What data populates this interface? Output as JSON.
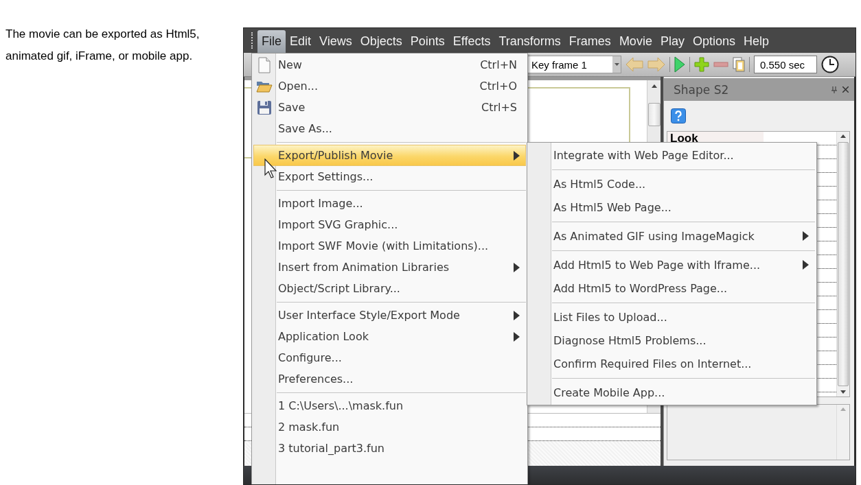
{
  "caption": "The movie can be exported as Html5, animated gif, iFrame, or mobile app.",
  "menubar": {
    "items": [
      {
        "label": "File",
        "selected": true
      },
      {
        "label": "Edit",
        "selected": false
      },
      {
        "label": "Views",
        "selected": false
      },
      {
        "label": "Objects",
        "selected": false
      },
      {
        "label": "Points",
        "selected": false
      },
      {
        "label": "Effects",
        "selected": false
      },
      {
        "label": "Transforms",
        "selected": false
      },
      {
        "label": "Frames",
        "selected": false
      },
      {
        "label": "Movie",
        "selected": false
      },
      {
        "label": "Play",
        "selected": false
      },
      {
        "label": "Options",
        "selected": false
      },
      {
        "label": "Help",
        "selected": false
      }
    ]
  },
  "toolbar": {
    "frame_select": "Key frame 1",
    "time_field": "0.550 sec"
  },
  "panel": {
    "title": "Shape S2",
    "section": "Look"
  },
  "file_menu": {
    "items": [
      {
        "kind": "item",
        "label": "New",
        "shortcut": "Ctrl+N",
        "selected": false,
        "has_submenu": false
      },
      {
        "kind": "item",
        "label": "Open...",
        "shortcut": "Ctrl+O",
        "selected": false,
        "has_submenu": false
      },
      {
        "kind": "item",
        "label": "Save",
        "shortcut": "Ctrl+S",
        "selected": false,
        "has_submenu": false
      },
      {
        "kind": "item",
        "label": "Save As...",
        "selected": false,
        "has_submenu": false
      },
      {
        "kind": "separator"
      },
      {
        "kind": "item",
        "label": "Export/Publish Movie",
        "selected": true,
        "has_submenu": true
      },
      {
        "kind": "item",
        "label": "Export Settings...",
        "selected": false,
        "has_submenu": false
      },
      {
        "kind": "separator"
      },
      {
        "kind": "item",
        "label": "Import Image...",
        "selected": false,
        "has_submenu": false
      },
      {
        "kind": "item",
        "label": "Import SVG Graphic...",
        "selected": false,
        "has_submenu": false
      },
      {
        "kind": "item",
        "label": "Import SWF Movie (with Limitations)...",
        "selected": false,
        "has_submenu": false
      },
      {
        "kind": "item",
        "label": "Insert from Animation Libraries",
        "selected": false,
        "has_submenu": true
      },
      {
        "kind": "item",
        "label": "Object/Script Library...",
        "selected": false,
        "has_submenu": false
      },
      {
        "kind": "separator"
      },
      {
        "kind": "item",
        "label": "User Interface Style/Export Mode",
        "selected": false,
        "has_submenu": true
      },
      {
        "kind": "item",
        "label": "Application Look",
        "selected": false,
        "has_submenu": true
      },
      {
        "kind": "item",
        "label": "Configure...",
        "selected": false,
        "has_submenu": false
      },
      {
        "kind": "item",
        "label": "Preferences...",
        "selected": false,
        "has_submenu": false
      },
      {
        "kind": "separator"
      },
      {
        "kind": "item",
        "label": "1 C:\\Users\\...\\mask.fun",
        "selected": false,
        "has_submenu": false
      },
      {
        "kind": "item",
        "label": "2 mask.fun",
        "selected": false,
        "has_submenu": false
      },
      {
        "kind": "item",
        "label": "3 tutorial_part3.fun",
        "selected": false,
        "has_submenu": false
      }
    ]
  },
  "export_submenu": {
    "items": [
      {
        "kind": "item",
        "label": "Integrate with Web Page Editor...",
        "selected": false,
        "has_submenu": false
      },
      {
        "kind": "separator"
      },
      {
        "kind": "item",
        "label": "As Html5 Code...",
        "selected": false,
        "has_submenu": false
      },
      {
        "kind": "item",
        "label": "As Html5 Web Page...",
        "selected": false,
        "has_submenu": false
      },
      {
        "kind": "separator"
      },
      {
        "kind": "item",
        "label": "As Animated GIF using ImageMagick",
        "selected": false,
        "has_submenu": true
      },
      {
        "kind": "separator"
      },
      {
        "kind": "item",
        "label": "Add Html5 to Web Page with Iframe...",
        "selected": false,
        "has_submenu": true
      },
      {
        "kind": "item",
        "label": "Add Html5 to WordPress Page...",
        "selected": false,
        "has_submenu": false
      },
      {
        "kind": "separator"
      },
      {
        "kind": "item",
        "label": "List Files to Upload...",
        "selected": false,
        "has_submenu": false
      },
      {
        "kind": "item",
        "label": "Diagnose Html5 Problems...",
        "selected": false,
        "has_submenu": false
      },
      {
        "kind": "item",
        "label": "Confirm Required Files on Internet...",
        "selected": false,
        "has_submenu": false
      },
      {
        "kind": "separator"
      },
      {
        "kind": "item",
        "label": "Create Mobile App...",
        "selected": false,
        "has_submenu": false
      }
    ]
  }
}
